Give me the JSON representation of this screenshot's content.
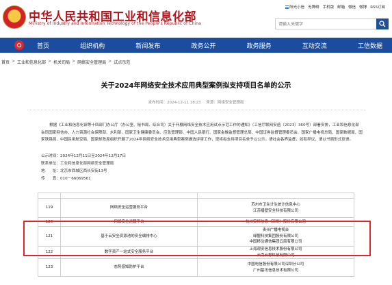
{
  "header": {
    "site_title": "中华人民共和国工业和信息化部",
    "site_subtitle": "Ministry of Industry and Information Technology of the People's Republic of China",
    "top_links": [
      "阳光小信",
      "无障碍",
      "手机版",
      "邮箱",
      "微信",
      "微博",
      "RSS订阅"
    ],
    "search_placeholder": "请输入关键字"
  },
  "nav": {
    "items": [
      "首页",
      "组织机构",
      "新闻发布",
      "政务公开",
      "政务服务",
      "互动交流",
      "工信数据"
    ]
  },
  "breadcrumb": [
    "首页",
    "工业和信息化部",
    "机关司局",
    "网络安全管理局",
    "试点示范"
  ],
  "article": {
    "title": "关于2024年网络安全技术应用典型案例拟支持项目名单的公示",
    "publish_date": "发布时间：2024-12-11 18:23",
    "source": "来源：网络安全管理局",
    "paragraph": "根据《工业和信息化部等十四部门办公厅（办公室、秘书局、综合司）关于开展网络安全技术应用试点示范工作的通知》（工信厅联网安函〔2023〕360号）部署安排，工业和信息化部会同国家网信办、人力资源社会保障部、水利部、国家卫生健康委员会、应急管理部、中国人民银行、国家金融监督管理总局、中国证券监督管理委员会、国家广播电视总局、国家数据局、国家铁路局、中国民用航空局、国家邮政局组织开展了2024年网络安全技术应用典型案例遴选评审工作，现将拟支持项目名单予以公示。请社会各界监督，如有异议，请以书面形式反馈。",
    "period": "公示时间：2024年12月11日至2024年12月17日",
    "contact_unit": "联系单位：工业和信息化部网络安全管理局",
    "address_label": "地　　址：",
    "address": "北京市西城区西长安街13号",
    "phone_label": "传　　真：",
    "phone": "010－66069561"
  },
  "table": {
    "rows": [
      {
        "num": "",
        "name": "",
        "orgs": [
          ""
        ]
      },
      {
        "num": "119",
        "name": "网络安全运营服务平台",
        "orgs": [
          "苏州市卫生计生统计信息中心",
          "江苏缙壁安全科技有限公司"
        ]
      },
      {
        "num": "120",
        "name": "网络安全运营平台",
        "orgs": [
          "杭州安恒信息（深圳）股份有限公司"
        ]
      },
      {
        "num": "121",
        "name": "基于云安全资源池的安全编排中心",
        "orgs": [
          "贵州广播电视台",
          "绿盟科技集团股份有限公司",
          "中国移动通信集团云南有限公司"
        ]
      },
      {
        "num": "122",
        "name": "数字资产一站式安全服务平台",
        "orgs": [
          "上海观安信息技术股份有限公司",
          "云南云思科技有限公司"
        ]
      },
      {
        "num": "123",
        "name": "态势感知防护平台",
        "orgs": [
          "中国电信股份有限公司深圳分公司",
          "广州基讯信息技术有限公司"
        ]
      }
    ]
  },
  "colors": {
    "brand_red": "#b4151d",
    "nav_blue": "#1c4c9e",
    "highlight_red": "#e0262c"
  }
}
